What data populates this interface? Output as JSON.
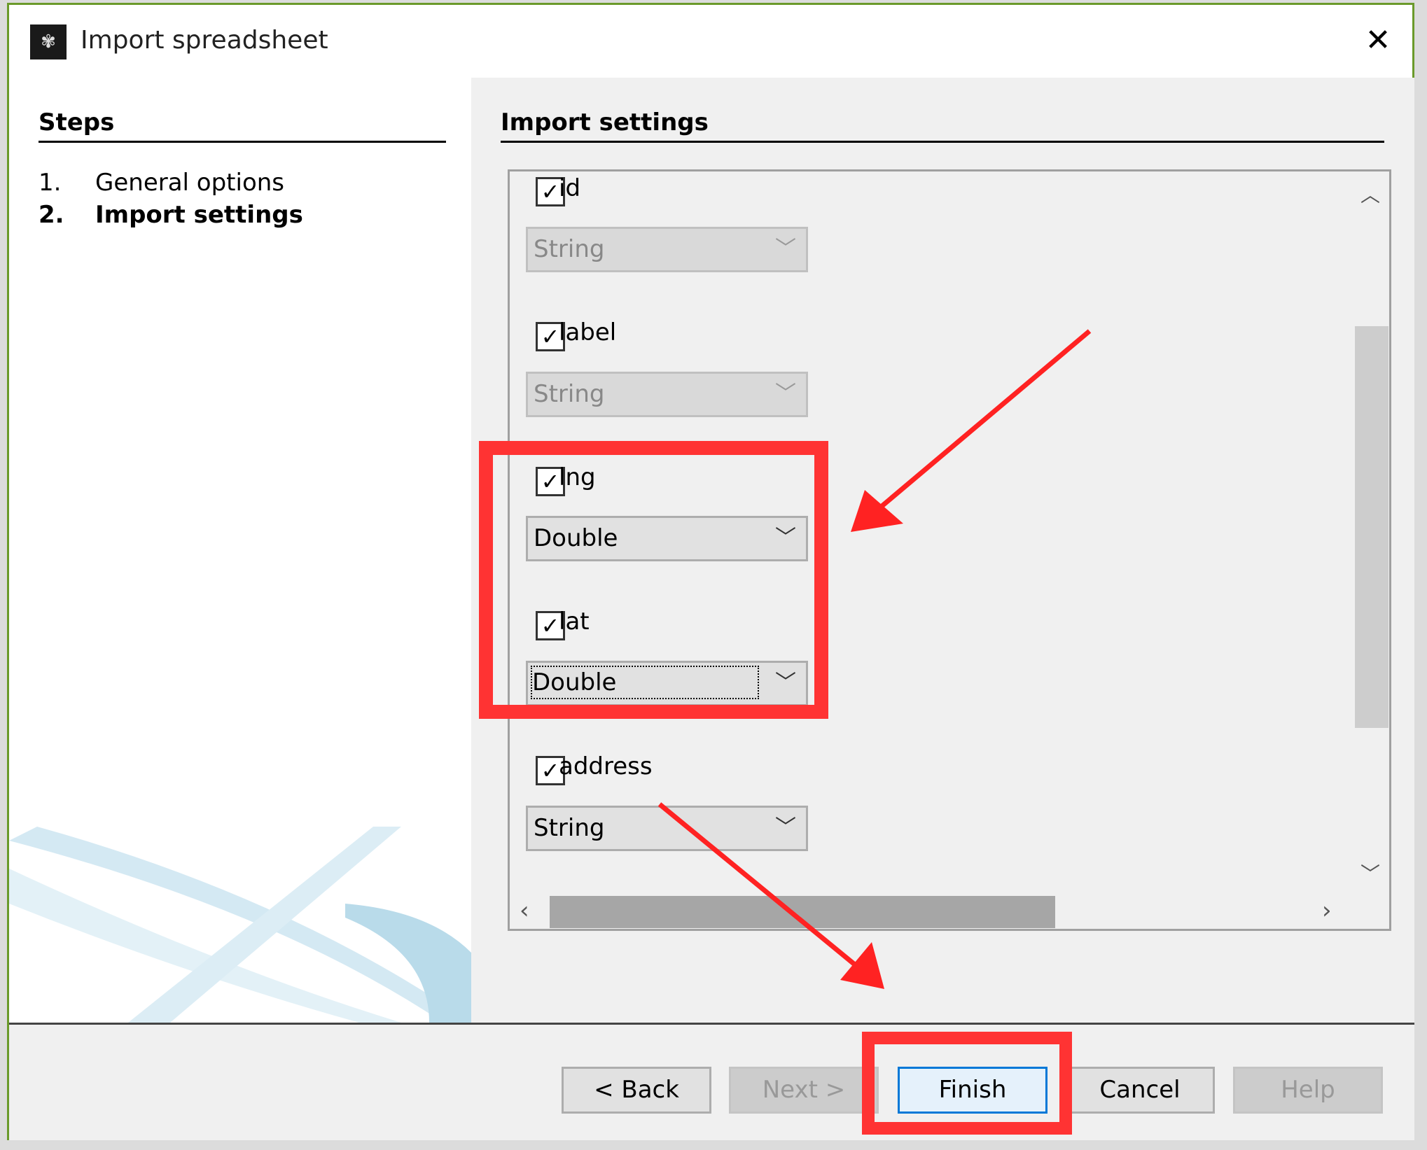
{
  "window": {
    "title": "Import spreadsheet",
    "icon": "app-logo-icon",
    "close_icon": "close-icon"
  },
  "steps": {
    "heading": "Steps",
    "items": [
      {
        "num": "1.",
        "label": "General options",
        "active": false
      },
      {
        "num": "2.",
        "label": "Import settings",
        "active": true
      }
    ]
  },
  "settings": {
    "heading": "Import settings",
    "columns": [
      {
        "name": "id",
        "checked": true,
        "type": "String",
        "enabled": false
      },
      {
        "name": "label",
        "checked": true,
        "type": "String",
        "enabled": false
      },
      {
        "name": "lng",
        "checked": true,
        "type": "Double",
        "enabled": true
      },
      {
        "name": "lat",
        "checked": true,
        "type": "Double",
        "enabled": true,
        "focused": true
      },
      {
        "name": "address",
        "checked": true,
        "type": "String",
        "enabled": true
      }
    ]
  },
  "buttons": {
    "back": "< Back",
    "next": "Next >",
    "finish": "Finish",
    "cancel": "Cancel",
    "help": "Help"
  },
  "colors": {
    "annotation": "#ff3333",
    "window_border": "#6a9a2a",
    "default_button": "#0078d7"
  }
}
